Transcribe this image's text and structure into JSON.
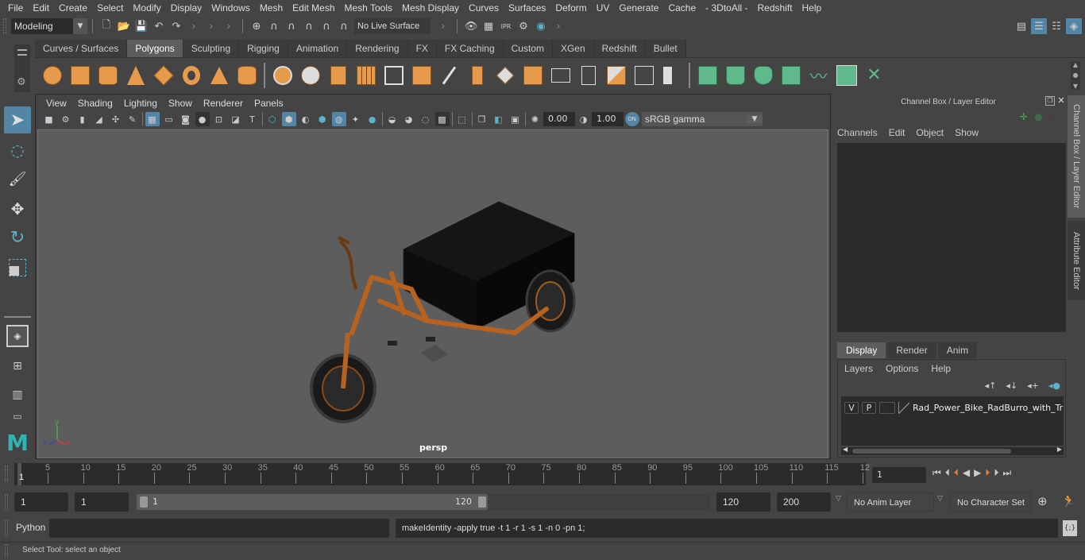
{
  "menubar": {
    "items": [
      "File",
      "Edit",
      "Create",
      "Select",
      "Modify",
      "Display",
      "Windows",
      "Mesh",
      "Edit Mesh",
      "Mesh Tools",
      "Mesh Display",
      "Curves",
      "Surfaces",
      "Deform",
      "UV",
      "Generate",
      "Cache",
      "- 3DtoAll -",
      "Redshift",
      "Help"
    ]
  },
  "statusline": {
    "workspace": "Modeling",
    "live_surface": "No Live Surface"
  },
  "shelf": {
    "tabs": [
      "Curves / Surfaces",
      "Polygons",
      "Sculpting",
      "Rigging",
      "Animation",
      "Rendering",
      "FX",
      "FX Caching",
      "Custom",
      "XGen",
      "Redshift",
      "Bullet"
    ],
    "active_tab": "Polygons"
  },
  "panel": {
    "menu": [
      "View",
      "Shading",
      "Lighting",
      "Show",
      "Renderer",
      "Panels"
    ],
    "exposure": "0.00",
    "gamma": "1.00",
    "color_mgmt_badge": "ON",
    "color_space": "sRGB gamma",
    "camera_label": "persp",
    "axis": {
      "x": "x",
      "y": "y",
      "z": "z"
    }
  },
  "channel_box": {
    "title": "Channel Box / Layer Editor",
    "menu": [
      "Channels",
      "Edit",
      "Object",
      "Show"
    ]
  },
  "layer_editor": {
    "tabs": [
      "Display",
      "Render",
      "Anim"
    ],
    "active_tab": "Display",
    "menu": [
      "Layers",
      "Options",
      "Help"
    ],
    "layers": [
      {
        "visible": "V",
        "playback": "P",
        "name": "Rad_Power_Bike_RadBurro_with_Truck"
      }
    ]
  },
  "side_tabs": [
    "Channel Box / Layer Editor",
    "Attribute Editor"
  ],
  "timeline": {
    "start_label": "1",
    "ticks": [
      "5",
      "10",
      "15",
      "20",
      "25",
      "30",
      "35",
      "40",
      "45",
      "50",
      "55",
      "60",
      "65",
      "70",
      "75",
      "80",
      "85",
      "90",
      "95",
      "100",
      "105",
      "110",
      "115",
      "12"
    ],
    "current_frame": "1"
  },
  "range": {
    "start": "1",
    "playback_start": "1",
    "slider_start": "1",
    "slider_end": "120",
    "playback_end": "120",
    "end": "200",
    "anim_layer": "No Anim Layer",
    "character_set": "No Character Set"
  },
  "cmdline": {
    "language": "Python",
    "input": "",
    "result": "makeIdentity -apply true -t 1 -r 1 -s 1 -n 0 -pn 1;"
  },
  "helpline": {
    "text": "Select Tool: select an object"
  },
  "colors": {
    "accent": "#5285a6",
    "shelf_orange": "#e59a4c",
    "shelf_green": "#5fb98a",
    "timeline_marker": "#e07b39"
  }
}
